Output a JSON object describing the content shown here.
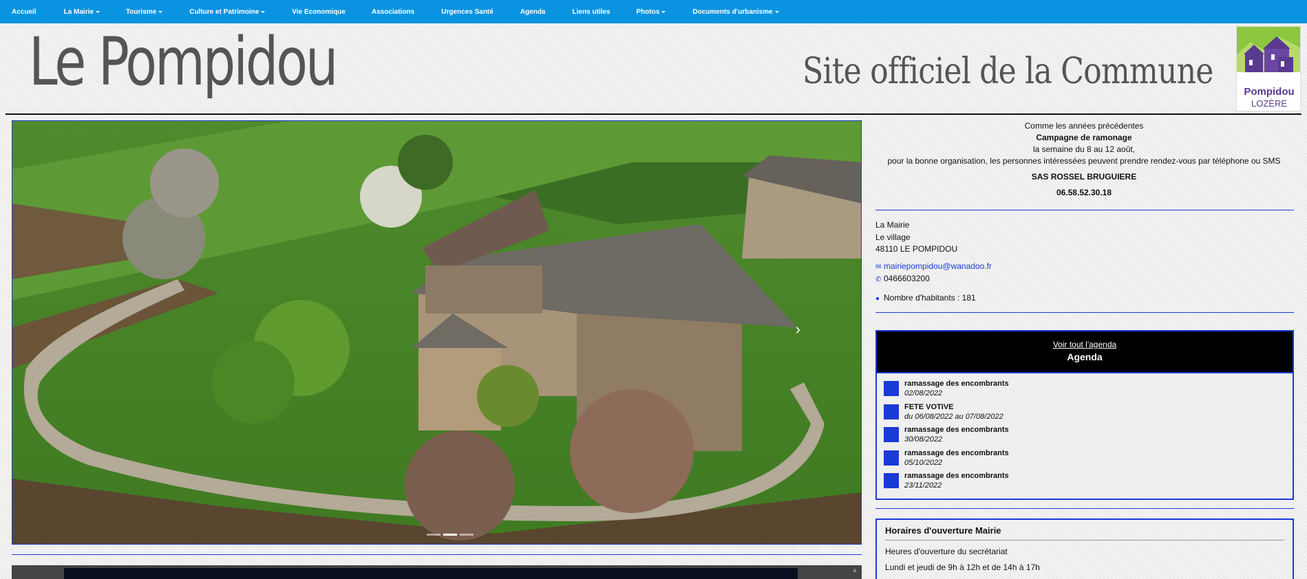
{
  "nav": {
    "items": [
      {
        "label": "Accueil",
        "dropdown": false
      },
      {
        "label": "La Mairie",
        "dropdown": true
      },
      {
        "label": "Tourisme",
        "dropdown": true
      },
      {
        "label": "Culture et Patrimoine",
        "dropdown": true
      },
      {
        "label": "Vie Economique",
        "dropdown": false
      },
      {
        "label": "Associations",
        "dropdown": false
      },
      {
        "label": "Urgences Santé",
        "dropdown": false
      },
      {
        "label": "Agenda",
        "dropdown": false
      },
      {
        "label": "Liens utiles",
        "dropdown": false
      },
      {
        "label": "Photos",
        "dropdown": true
      },
      {
        "label": "Documents d'urbanisme",
        "dropdown": true
      }
    ]
  },
  "header": {
    "site_name": "Le Pompidou",
    "tagline": "Site officiel de la Commune",
    "logo": {
      "line1": "Pompidou",
      "line2": "LOZÈRE"
    }
  },
  "colors": {
    "nav_bg": "#0a93e0",
    "accent": "#1a3ad6",
    "logo_purple": "#5a3a8f",
    "logo_green": "#8dc63f"
  },
  "carousel": {
    "slides": 3,
    "active_slide": 1,
    "next_icon": "chevron-right-icon"
  },
  "notice": {
    "line1": "Comme les années précédentes",
    "line2": "Campagne de ramonage",
    "line3": "la semaine du 8 au 12 août,",
    "line4": "pour la bonne organisation, les personnes intéressées peuvent prendre rendez-vous par téléphone ou SMS",
    "company": "SAS ROSSEL BRUGUIERE",
    "phone": "06.58.52.30.18"
  },
  "contact": {
    "name": "La Mairie",
    "street": "Le village",
    "city": "48110 LE POMPIDOU",
    "email": "mairiepompidou@wanadoo.fr",
    "phone": "0466603200",
    "population": "Nombre d'habitants : 181"
  },
  "agenda": {
    "link": "Voir tout l'agenda",
    "title": "Agenda",
    "items": [
      {
        "title": "ramassage des encombrants",
        "date": "02/08/2022"
      },
      {
        "title": "FETE VOTIVE",
        "date": "du 06/08/2022 au 07/08/2022"
      },
      {
        "title": "ramassage des encombrants",
        "date": "30/08/2022"
      },
      {
        "title": "ramassage des encombrants",
        "date": "05/10/2022"
      },
      {
        "title": "ramassage des encombrants",
        "date": "23/11/2022"
      }
    ]
  },
  "hours": {
    "title": "Horaires d'ouverture Mairie",
    "line1": "Heures d'ouverture du secrétariat",
    "line2": "Lundi et jeudi de 9h à 12h et de 14h à 17h"
  }
}
